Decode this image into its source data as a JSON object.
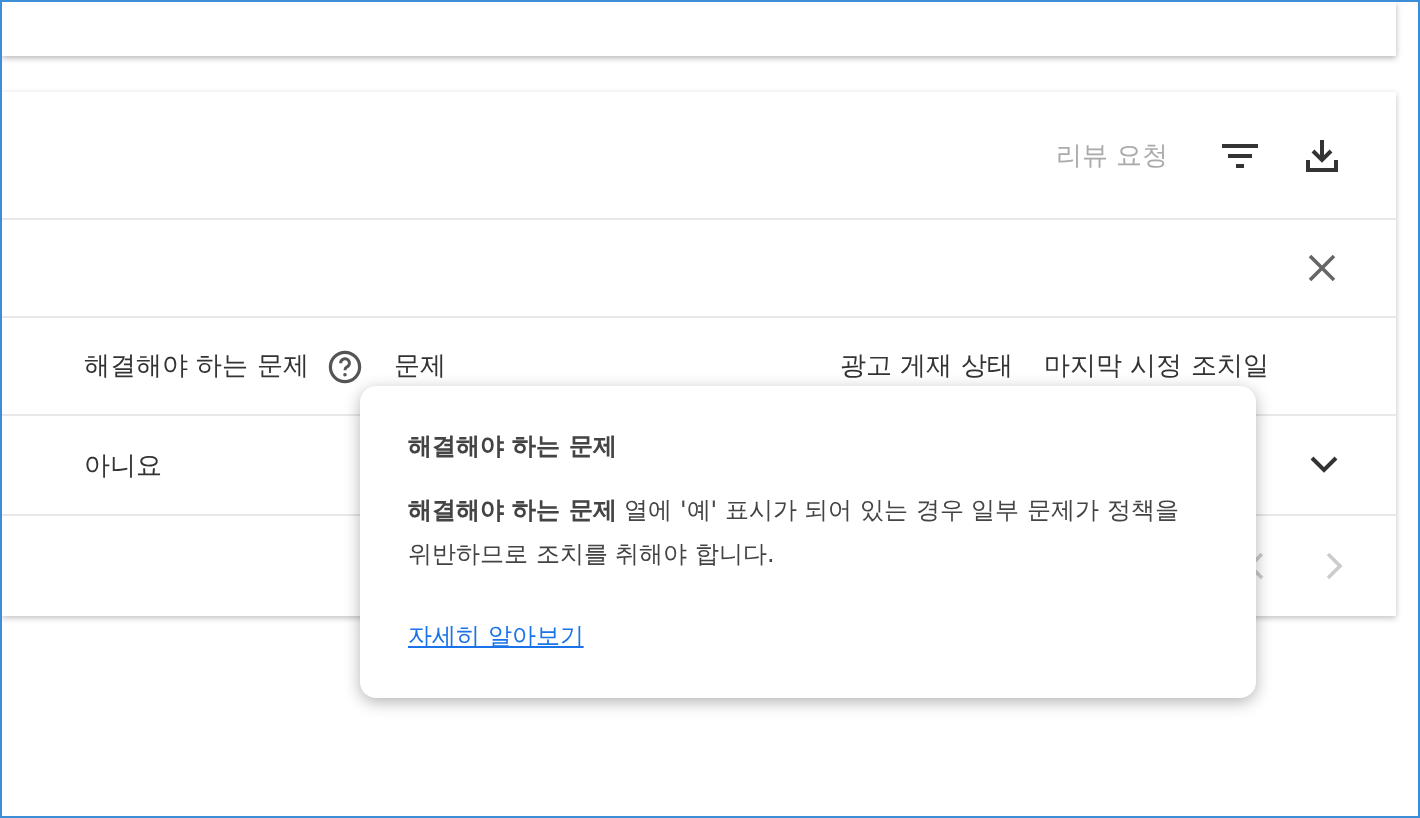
{
  "toolbar": {
    "review_request": {
      "label": "리뷰 요청",
      "disabled": true
    }
  },
  "table": {
    "columns": [
      {
        "label": "해결해야 하는 문제",
        "help": true
      },
      {
        "label": "문제",
        "help": false
      },
      {
        "label": "광고 게재 상태",
        "help": false
      },
      {
        "label": "마지막 시정 조치일",
        "help": false
      }
    ],
    "rows": [
      {
        "cells": [
          "아니요"
        ],
        "expanded": false
      }
    ]
  },
  "pagination": {
    "prev_disabled": true,
    "next_disabled": true
  },
  "tooltip": {
    "title": "해결해야 하는 문제",
    "body": "**해결해야 하는 문제** 열에 '예' 표시가 되어 있는 경우 일부 문제가 정책을 위반하므로 조치를 취해야 합니다.",
    "link": "자세히 알아보기"
  }
}
